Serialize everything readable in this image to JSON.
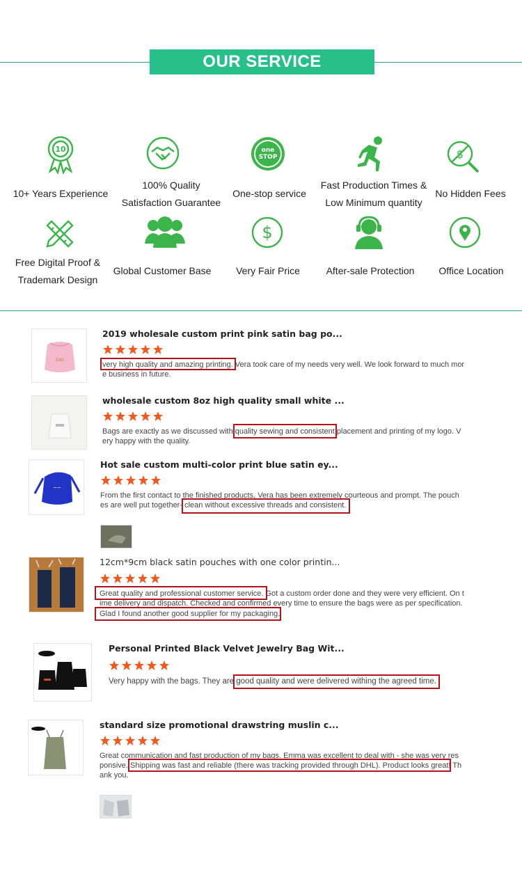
{
  "header": {
    "title": "OUR SERVICE"
  },
  "colors": {
    "accent": "#27c08a",
    "line": "#2f9e8f",
    "icon": "#3bb54a",
    "star": "#f05a1e",
    "highlight": "#b5121b"
  },
  "services": [
    {
      "icon": "medal-ten-icon",
      "label1": "10+ Years Experience",
      "label2": ""
    },
    {
      "icon": "handshake-icon",
      "label1": "100% Quality",
      "label2": "Satisfaction Guarantee"
    },
    {
      "icon": "one-stop-icon",
      "label1": "One-stop service",
      "label2": ""
    },
    {
      "icon": "running-man-icon",
      "label1": "Fast Production Times &",
      "label2": "Low Minimum quantity"
    },
    {
      "icon": "no-hidden-fee-icon",
      "label1": "No Hidden Fees",
      "label2": ""
    },
    {
      "icon": "ruler-pencil-icon",
      "label1": "Free Digital Proof &",
      "label2": "Trademark Design"
    },
    {
      "icon": "customers-icon",
      "label1": "Global Customer Base",
      "label2": ""
    },
    {
      "icon": "dollar-icon",
      "label1": "Very Fair Price",
      "label2": ""
    },
    {
      "icon": "headset-support-icon",
      "label1": "After-sale Protection",
      "label2": ""
    },
    {
      "icon": "location-pin-icon",
      "label1": "Office Location",
      "label2": ""
    }
  ],
  "reviews": [
    {
      "title": "2019 wholesale custom print pink satin bag po...",
      "rating": 5,
      "line1": "very high quality and amazing printing. Vera took care of my needs very well. We look forward to much mor",
      "line2": "e business in future.",
      "line3": ""
    },
    {
      "title": "wholesale custom 8oz high quality small white ...",
      "rating": 5,
      "line1": "Bags are exactly as we discussed with quality sewing and consistent placement and printing of my logo. V",
      "line2": "ery happy with the quality.",
      "line3": ""
    },
    {
      "title": "Hot sale custom multi-color print blue satin ey...",
      "rating": 5,
      "line1": "From the first contact to the finished products, Vera has been extremely courteous and prompt. The pouch",
      "line2": "es are well put together- clean without excessive threads and consistent.",
      "line3": ""
    },
    {
      "title": "12cm*9cm black satin pouches with one color printin...",
      "rating": 5,
      "line1": "Great quality and professional customer service. Got a custom order done and they were very efficient. On t",
      "line2": "ime delivery and dispatch. Checked and confirmed every time to ensure the bags were as per specification.",
      "line3": "Glad I found another good supplier for my packaging."
    },
    {
      "title": "Personal Printed Black Velvet Jewelry Bag Wit...",
      "rating": 5,
      "line1": "Very happy with the bags. They are good quality and were delivered withing the agreed time.",
      "line2": "",
      "line3": ""
    },
    {
      "title": "standard size promotional drawstring muslin c...",
      "rating": 5,
      "line1": "Great communication and fast production of my bags. Emma was excellent to deal with - she was very res",
      "line2": "ponsive. Shipping was fast and reliable (there was tracking provided through DHL). Product looks great! Th",
      "line3": "ank you."
    }
  ]
}
